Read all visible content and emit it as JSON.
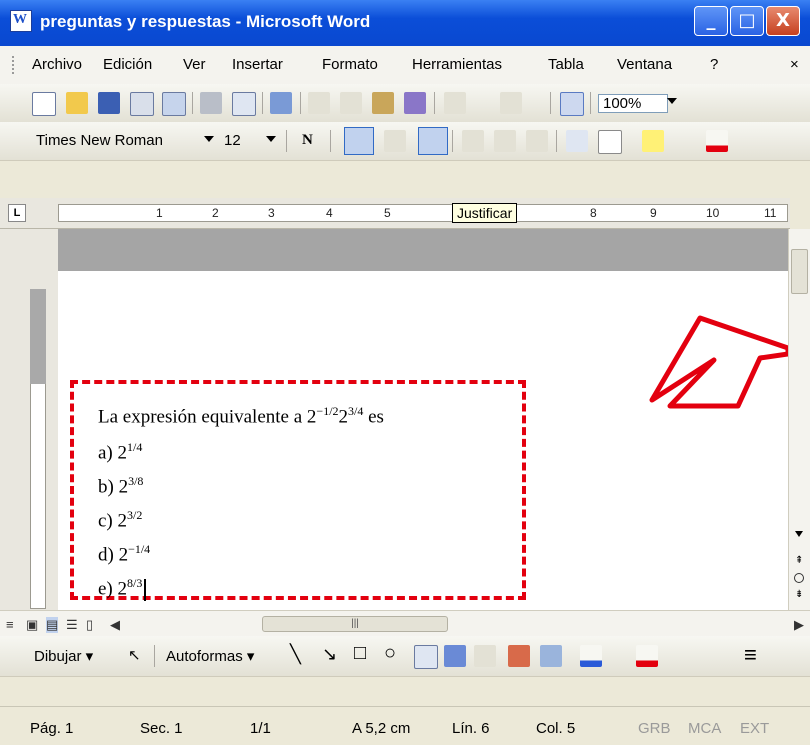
{
  "window": {
    "title": "preguntas y respuestas - Microsoft Word",
    "min_label": "_",
    "max_label": "□",
    "close_label": "X"
  },
  "menu": {
    "items": [
      "Archivo",
      "Edición",
      "Ver",
      "Insertar",
      "Formato",
      "Herramientas",
      "Tabla",
      "Ventana",
      "?"
    ],
    "close_doc": "×"
  },
  "standard_toolbar": {
    "zoom": "100%"
  },
  "format_toolbar": {
    "font": "Times New Roman",
    "size": "12",
    "bold": "N"
  },
  "ruler": {
    "numbers": [
      "1",
      "2",
      "3",
      "4",
      "5",
      "8",
      "9",
      "10",
      "11"
    ],
    "tooltip": "Justificar"
  },
  "question": {
    "stem_text": "La expresión equivalente a ",
    "stem_base1": "2",
    "stem_exp1": "−1/2",
    "stem_base2": "2",
    "stem_exp2": "3/4",
    "stem_suffix": " es",
    "options": [
      {
        "label": "a) ",
        "base": "2",
        "exp": "1/4"
      },
      {
        "label": "b) ",
        "base": "2",
        "exp": "3/8"
      },
      {
        "label": "c) ",
        "base": "2",
        "exp": "3/2"
      },
      {
        "label": "d) ",
        "base": "2",
        "exp": "−1/4"
      },
      {
        "label": "e) ",
        "base": "2",
        "exp": "8/3"
      }
    ]
  },
  "draw_toolbar": {
    "draw_label": "Dibujar ▾",
    "autoshapes_label": "Autoformas ▾"
  },
  "status": {
    "page": "Pág. 1",
    "section": "Sec. 1",
    "pages": "1/1",
    "at": "A 5,2 cm",
    "line": "Lín. 6",
    "col": "Col. 5",
    "grb": "GRB",
    "mca": "MCA",
    "ext": "EXT"
  },
  "colors": {
    "titlebar": "#0b4ed8",
    "annotation_red": "#e3000f"
  }
}
